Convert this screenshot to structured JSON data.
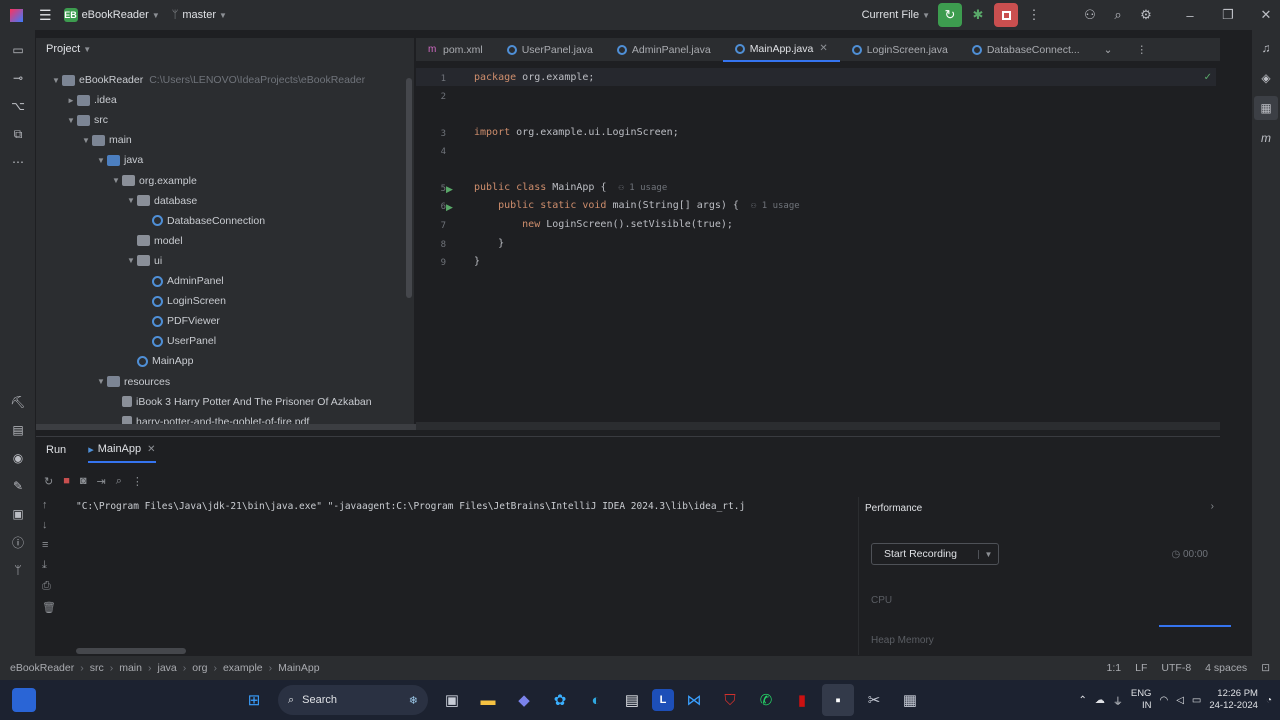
{
  "titlebar": {
    "project_initials": "EB",
    "project_name": "eBookReader",
    "branch": "master",
    "run_config": "Current File"
  },
  "project_panel": {
    "title": "Project",
    "tree": [
      {
        "label": "eBookReader",
        "path": "C:\\Users\\LENOVO\\IdeaProjects\\eBookReader",
        "kind": "folder"
      },
      {
        "label": ".idea",
        "kind": "folder"
      },
      {
        "label": "src",
        "kind": "folder"
      },
      {
        "label": "main",
        "kind": "folder"
      },
      {
        "label": "java",
        "kind": "src"
      },
      {
        "label": "org.example",
        "kind": "package"
      },
      {
        "label": "database",
        "kind": "package"
      },
      {
        "label": "DatabaseConnection",
        "kind": "class"
      },
      {
        "label": "model",
        "kind": "package"
      },
      {
        "label": "ui",
        "kind": "package"
      },
      {
        "label": "AdminPanel",
        "kind": "class"
      },
      {
        "label": "LoginScreen",
        "kind": "class"
      },
      {
        "label": "PDFViewer",
        "kind": "class"
      },
      {
        "label": "UserPanel",
        "kind": "class"
      },
      {
        "label": "MainApp",
        "kind": "class"
      },
      {
        "label": "resources",
        "kind": "folder"
      },
      {
        "label": "iBook 3 Harry Potter And The Prisoner Of Azkaban",
        "kind": "pdf"
      },
      {
        "label": "harry-potter-and-the-goblet-of-fire.pdf",
        "kind": "pdf"
      }
    ]
  },
  "editor": {
    "tabs": [
      {
        "label": "pom.xml",
        "active": false
      },
      {
        "label": "UserPanel.java",
        "active": false
      },
      {
        "label": "AdminPanel.java",
        "active": false
      },
      {
        "label": "MainApp.java",
        "active": true
      },
      {
        "label": "LoginScreen.java",
        "active": false
      },
      {
        "label": "DatabaseConnect...",
        "active": false
      }
    ],
    "lines": [
      {
        "n": "1",
        "t1": "package ",
        "t2": "org.example;",
        "hint": ""
      },
      {
        "n": "2",
        "t1": "",
        "t2": "",
        "hint": ""
      },
      {
        "n": "3",
        "t1": "import ",
        "t2": "org.example.ui.LoginScreen;",
        "hint": ""
      },
      {
        "n": "4",
        "t1": "",
        "t2": "",
        "hint": ""
      },
      {
        "n": "5",
        "t1": "public class ",
        "t2": "MainApp {",
        "hint": "1 usage"
      },
      {
        "n": "6",
        "t1": "    public static void ",
        "t2": "main(String[] args) {",
        "hint": "1 usage"
      },
      {
        "n": "7",
        "t1": "        new ",
        "t2": "LoginScreen().setVisible(true);",
        "hint": ""
      },
      {
        "n": "8",
        "t1": "    ",
        "t2": "}",
        "hint": ""
      },
      {
        "n": "9",
        "t1": "",
        "t2": "}",
        "hint": ""
      }
    ]
  },
  "bottom_panel": {
    "tab_run": "Run",
    "tab_config": "MainApp",
    "console_line": "\"C:\\Program Files\\Java\\jdk-21\\bin\\java.exe\" \"-javaagent:C:\\Program Files\\JetBrains\\IntelliJ IDEA 2024.3\\lib\\idea_rt.j",
    "performance": {
      "title": "Performance",
      "record_label": "Start Recording",
      "timer": "00:00",
      "cpu_label": "CPU",
      "heap_label": "Heap Memory"
    }
  },
  "statusbar": {
    "crumbs": [
      "eBookReader",
      "src",
      "main",
      "java",
      "org",
      "example",
      "MainApp"
    ],
    "position": "1:1",
    "line_sep": "LF",
    "encoding": "UTF-8",
    "indent": "4 spaces"
  },
  "taskbar": {
    "search_label": "Search",
    "lang": "ENG",
    "lang_region": "IN",
    "time": "12:26 PM",
    "date": "24-12-2024"
  }
}
